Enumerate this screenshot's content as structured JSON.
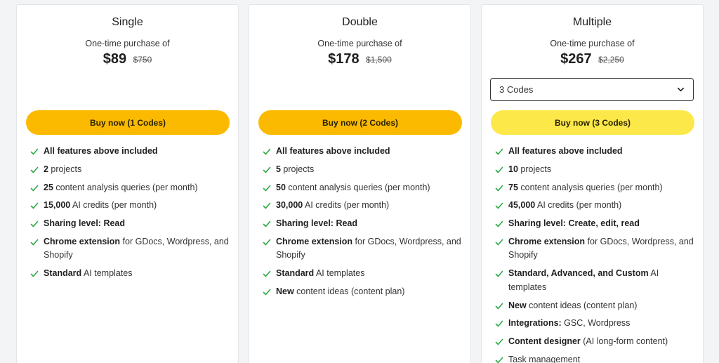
{
  "accent_color": "#fbba00",
  "accent_light_color": "#fde84a",
  "check_color": "#2eaa48",
  "icons": {
    "check": "check-icon",
    "dropdown": "chevron-down-icon"
  },
  "plans": [
    {
      "name": "Single",
      "purchase_label": "One-time purchase of",
      "price": "$89",
      "old_price": "$750",
      "buy_label": "Buy now (1 Codes)",
      "features": [
        {
          "bold": "All features above included",
          "rest": ""
        },
        {
          "bold": "2",
          "rest": " projects"
        },
        {
          "bold": "25",
          "rest": " content analysis queries (per month)"
        },
        {
          "bold": "15,000",
          "rest": " AI credits (per month)"
        },
        {
          "bold": "Sharing level: Read",
          "rest": ""
        },
        {
          "bold": "Chrome extension",
          "rest": " for GDocs, Wordpress, and Shopify"
        },
        {
          "bold": "Standard",
          "rest": " AI templates"
        }
      ]
    },
    {
      "name": "Double",
      "purchase_label": "One-time purchase of",
      "price": "$178",
      "old_price": "$1,500",
      "buy_label": "Buy now (2 Codes)",
      "features": [
        {
          "bold": "All features above included",
          "rest": ""
        },
        {
          "bold": "5",
          "rest": " projects"
        },
        {
          "bold": "50",
          "rest": " content analysis queries (per month)"
        },
        {
          "bold": "30,000",
          "rest": " AI credits (per month)"
        },
        {
          "bold": "Sharing level: Read",
          "rest": ""
        },
        {
          "bold": "Chrome extension",
          "rest": " for GDocs, Wordpress, and Shopify"
        },
        {
          "bold": "Standard",
          "rest": " AI templates"
        },
        {
          "bold": "New",
          "rest": " content ideas (content plan)"
        }
      ]
    },
    {
      "name": "Multiple",
      "purchase_label": "One-time purchase of",
      "price": "$267",
      "old_price": "$2,250",
      "select_value": "3 Codes",
      "buy_label": "Buy now (3 Codes)",
      "features": [
        {
          "bold": "All features above included",
          "rest": ""
        },
        {
          "bold": "10",
          "rest": " projects"
        },
        {
          "bold": "75",
          "rest": " content analysis queries (per month)"
        },
        {
          "bold": "45,000",
          "rest": " AI credits (per month)"
        },
        {
          "bold": "Sharing level: Create, edit, read",
          "rest": ""
        },
        {
          "bold": "Chrome extension",
          "rest": " for GDocs, Wordpress, and Shopify"
        },
        {
          "bold": "Standard, Advanced, and Custom",
          "rest": " AI templates"
        },
        {
          "bold": "New",
          "rest": " content ideas (content plan)"
        },
        {
          "bold": "Integrations:",
          "rest": " GSC, Wordpress"
        },
        {
          "bold": "Content designer",
          "rest": " (AI long-form content)"
        },
        {
          "bold": "",
          "rest": "Task management"
        }
      ]
    }
  ]
}
